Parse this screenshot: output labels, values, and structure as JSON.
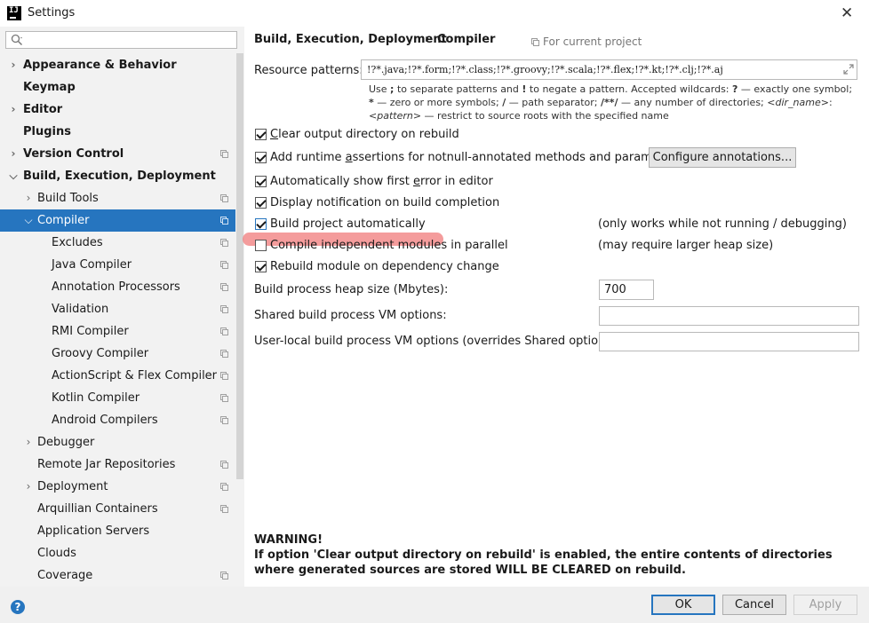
{
  "window": {
    "title": "Settings",
    "icon": "intellij-logo",
    "icon_text": "IJ"
  },
  "search": {
    "placeholder": ""
  },
  "sidebar": {
    "items": [
      {
        "label": "Appearance & Behavior",
        "bold": true,
        "level": 0,
        "arrow": "right",
        "copy": false
      },
      {
        "label": "Keymap",
        "bold": true,
        "level": 0,
        "arrow": "",
        "copy": false
      },
      {
        "label": "Editor",
        "bold": true,
        "level": 0,
        "arrow": "right",
        "copy": false
      },
      {
        "label": "Plugins",
        "bold": true,
        "level": 0,
        "arrow": "",
        "copy": false
      },
      {
        "label": "Version Control",
        "bold": true,
        "level": 0,
        "arrow": "right",
        "copy": true
      },
      {
        "label": "Build, Execution, Deployment",
        "bold": true,
        "level": 0,
        "arrow": "down",
        "copy": false
      },
      {
        "label": "Build Tools",
        "bold": false,
        "level": 1,
        "arrow": "right",
        "copy": true
      },
      {
        "label": "Compiler",
        "bold": false,
        "level": 1,
        "arrow": "down",
        "copy": true,
        "selected": true
      },
      {
        "label": "Excludes",
        "bold": false,
        "level": 2,
        "arrow": "",
        "copy": true
      },
      {
        "label": "Java Compiler",
        "bold": false,
        "level": 2,
        "arrow": "",
        "copy": true
      },
      {
        "label": "Annotation Processors",
        "bold": false,
        "level": 2,
        "arrow": "",
        "copy": true
      },
      {
        "label": "Validation",
        "bold": false,
        "level": 2,
        "arrow": "",
        "copy": true
      },
      {
        "label": "RMI Compiler",
        "bold": false,
        "level": 2,
        "arrow": "",
        "copy": true
      },
      {
        "label": "Groovy Compiler",
        "bold": false,
        "level": 2,
        "arrow": "",
        "copy": true
      },
      {
        "label": "ActionScript & Flex Compiler",
        "bold": false,
        "level": 2,
        "arrow": "",
        "copy": true
      },
      {
        "label": "Kotlin Compiler",
        "bold": false,
        "level": 2,
        "arrow": "",
        "copy": true
      },
      {
        "label": "Android Compilers",
        "bold": false,
        "level": 2,
        "arrow": "",
        "copy": true
      },
      {
        "label": "Debugger",
        "bold": false,
        "level": 1,
        "arrow": "right",
        "copy": false
      },
      {
        "label": "Remote Jar Repositories",
        "bold": false,
        "level": 1,
        "arrow": "",
        "copy": true
      },
      {
        "label": "Deployment",
        "bold": false,
        "level": 1,
        "arrow": "right",
        "copy": true
      },
      {
        "label": "Arquillian Containers",
        "bold": false,
        "level": 1,
        "arrow": "",
        "copy": true
      },
      {
        "label": "Application Servers",
        "bold": false,
        "level": 1,
        "arrow": "",
        "copy": false
      },
      {
        "label": "Clouds",
        "bold": false,
        "level": 1,
        "arrow": "",
        "copy": false
      },
      {
        "label": "Coverage",
        "bold": false,
        "level": 1,
        "arrow": "",
        "copy": true
      }
    ]
  },
  "header": {
    "crumb_parent": "Build, Execution, Deployment",
    "crumb_sep": "›",
    "crumb_current": "Compiler",
    "for_project": "For current project"
  },
  "resource": {
    "label": "Resource patterns:",
    "value": "!?*.java;!?*.form;!?*.class;!?*.groovy;!?*.scala;!?*.flex;!?*.kt;!?*.clj;!?*.aj"
  },
  "help": {
    "t1": "Use ",
    "b1": ";",
    "t2": " to separate patterns and ",
    "b2": "!",
    "t3": " to negate a pattern. Accepted wildcards: ",
    "b3": "?",
    "t4": " — exactly one symbol; ",
    "b4": "*",
    "t5": " — zero or more symbols; ",
    "b5": "/",
    "t6": " — path separator; ",
    "b6": "/**/",
    "t7": " — any number of directories; ",
    "i1": "<dir_name>",
    "t8": ":",
    "i2": "<pattern>",
    "t9": " — restrict to source roots with the specified name"
  },
  "options": {
    "clear_output": {
      "pre": "",
      "u": "C",
      "post": "lear output directory on rebuild",
      "checked": true
    },
    "runtime_assert": {
      "pre": "Add runtime ",
      "u": "a",
      "post": "ssertions for notnull-annotated methods and parameters",
      "checked": true
    },
    "configure_button": "Configure annotations...",
    "show_error": {
      "pre": "Automatically show first ",
      "u": "e",
      "post": "rror in editor",
      "checked": true
    },
    "display_notification": {
      "label": "Display notification on build completion",
      "checked": true
    },
    "build_auto": {
      "label": "Build project automatically",
      "checked": true,
      "note": "(only works while not running / debugging)"
    },
    "compile_parallel": {
      "label": "Compile independent modules in parallel",
      "checked": false,
      "note": "(may require larger heap size)"
    },
    "rebuild_module": {
      "label": "Rebuild module on dependency change",
      "checked": true
    }
  },
  "heap": {
    "label": "Build process heap size (Mbytes):",
    "value": "700"
  },
  "shared_vm": {
    "label": "Shared build process VM options:",
    "value": ""
  },
  "user_vm": {
    "label": "User-local build process VM options (overrides Shared options):",
    "value": ""
  },
  "warning": {
    "title": "WARNING!",
    "body": "If option 'Clear output directory on rebuild' is enabled, the entire contents of directories where generated sources are stored WILL BE CLEARED on rebuild."
  },
  "footer": {
    "help": "?",
    "ok": "OK",
    "cancel": "Cancel",
    "apply": "Apply"
  },
  "colors": {
    "accent": "#2675bf",
    "highlight": "#f07b7b",
    "sidebar_bg": "#f2f2f2"
  }
}
